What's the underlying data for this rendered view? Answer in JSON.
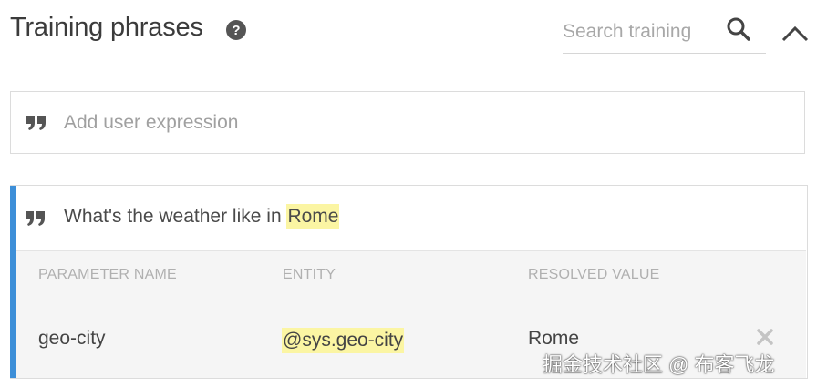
{
  "header": {
    "title": "Training phrases",
    "search_placeholder": "Search training"
  },
  "add_expression": {
    "placeholder": "Add user expression"
  },
  "phrase": {
    "text_prefix": "What's the weather like in ",
    "annotated_text": "Rome"
  },
  "parameters": {
    "columns": [
      "PARAMETER NAME",
      "ENTITY",
      "RESOLVED VALUE"
    ],
    "rows": [
      {
        "name": "geo-city",
        "entity": "@sys.geo-city",
        "resolved_value": "Rome"
      }
    ]
  },
  "watermark": "掘金技术社区 @ 布客飞龙",
  "colors": {
    "accent": "#3d8fd8",
    "highlight": "#fbf5a3"
  },
  "icons": [
    "help-icon",
    "search-icon",
    "chevron-up-icon",
    "quote-icon",
    "close-icon"
  ]
}
